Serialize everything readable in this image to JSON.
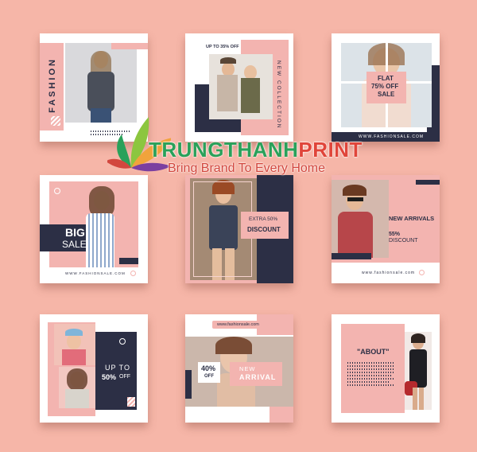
{
  "cards": {
    "fashion": {
      "label": "FASHION"
    },
    "collection": {
      "promo": "UP TO 35% OFF",
      "label": "NEW COLLECTION"
    },
    "flat": {
      "line1": "FLAT",
      "line2": "75% OFF",
      "line3": "SALE",
      "site": "WWW.FASHIONSALE.COM"
    },
    "bigsale": {
      "line1": "BIG",
      "line2": "SALE",
      "site": "WWW.FASHIONSALE.COM"
    },
    "extra": {
      "line1": "EXTRA 50%",
      "line2": "DISCOUNT"
    },
    "arrivals": {
      "title": "NEW ARRIVALS",
      "pct": "55%",
      "discount": "DISCOUNT",
      "site": "www.fashionsale.com"
    },
    "upto": {
      "line1": "UP TO",
      "pct": "50%",
      "off": "OFF"
    },
    "newarrival": {
      "site": "www.fashionsale.com",
      "pct": "40%",
      "off": "OFF",
      "line1": "NEW",
      "line2": "ARRIVAL"
    },
    "about": {
      "title": "\"ABOUT\""
    }
  },
  "watermark": {
    "brand_part1": "TRUNGTHANH",
    "brand_part2": "PRINT",
    "tagline": "Bring Brand To Every Home"
  }
}
